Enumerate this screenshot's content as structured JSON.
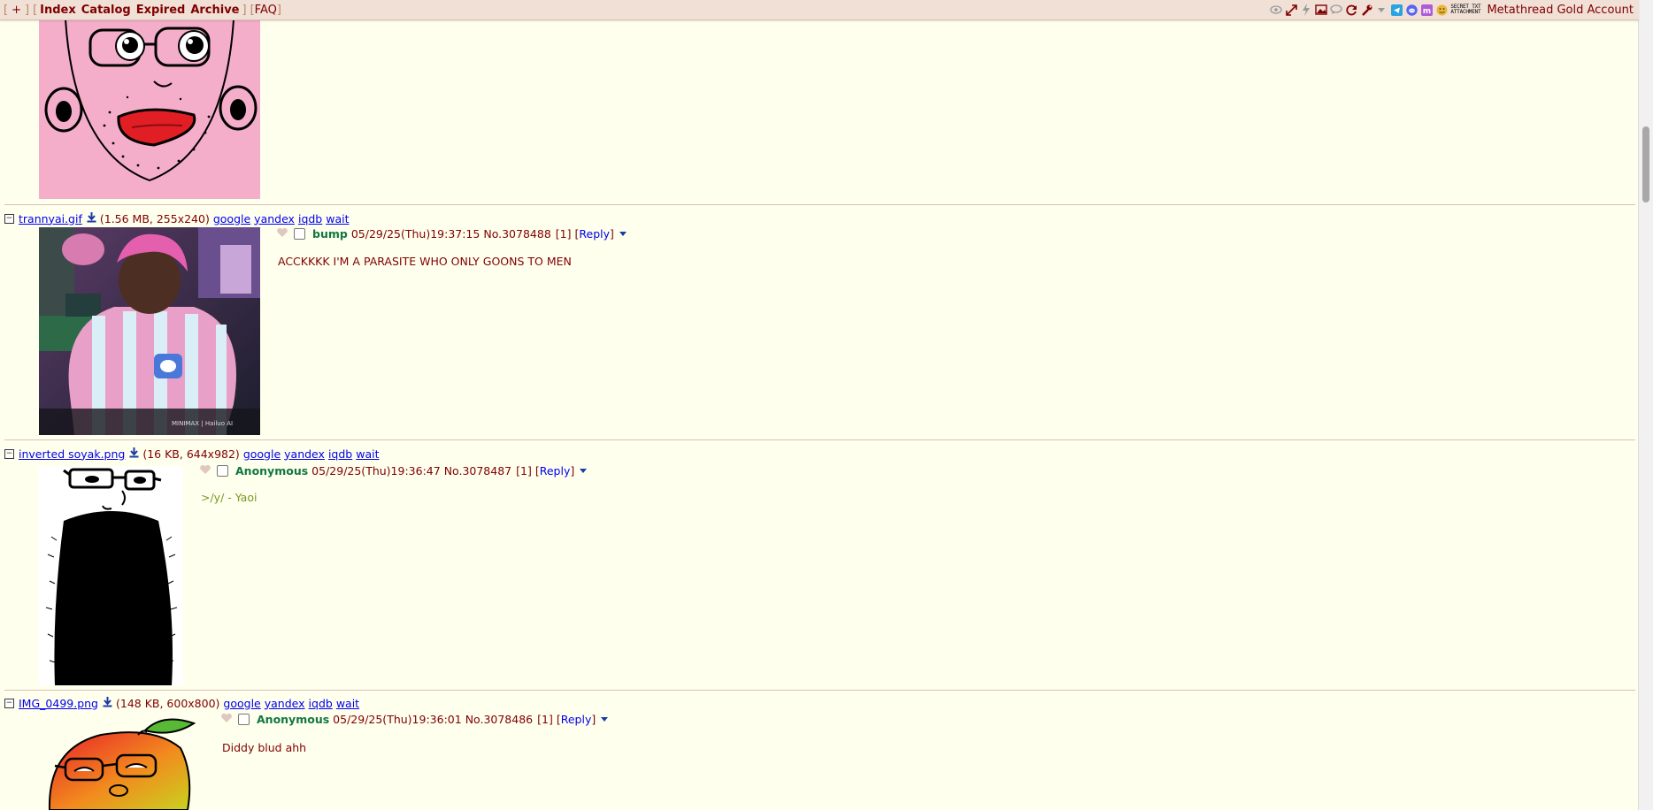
{
  "topbar": {
    "bracket_open": "[",
    "plus": "+",
    "bracket_close": "]",
    "links": [
      "Index",
      "Catalog",
      "Expired",
      "Archive"
    ],
    "faq": "FAQ",
    "secret_line1": "SECRET TXT",
    "secret_line2": "ATTACHMENT",
    "account": "Metathread Gold Account",
    "icons": [
      "eye-icon",
      "expand-icon",
      "lightning-icon",
      "image-icon",
      "speech-bubble-icon",
      "refresh-icon",
      "wrench-icon",
      "dropdown-arrow-icon",
      "telegram-icon",
      "discord-icon",
      "matrix-icon",
      "emoji-icon"
    ]
  },
  "posts": [
    {
      "filename": "trannyai.gif",
      "meta": "(1.56 MB, 255x240)",
      "search_links": [
        "google",
        "yandex",
        "iqdb",
        "wait"
      ],
      "name": "bump",
      "datetime": "05/29/25(Thu)19:37:15",
      "number": "No.3078488",
      "replies": "[1]",
      "reply_label": "Reply",
      "message": "ACCKKKK I'M A PARASITE WHO ONLY GOONS TO MEN",
      "greentext": false
    },
    {
      "filename": "inverted soyak.png",
      "meta": "(16 KB, 644x982)",
      "search_links": [
        "google",
        "yandex",
        "iqdb",
        "wait"
      ],
      "name": "Anonymous",
      "datetime": "05/29/25(Thu)19:36:47",
      "number": "No.3078487",
      "replies": "[1]",
      "reply_label": "Reply",
      "message": ">/y/ - Yaoi",
      "greentext": true
    },
    {
      "filename": "IMG_0499.png",
      "meta": "(148 KB, 600x800)",
      "search_links": [
        "google",
        "yandex",
        "iqdb",
        "wait"
      ],
      "name": "Anonymous",
      "datetime": "05/29/25(Thu)19:36:01",
      "number": "No.3078486",
      "replies": "[1]",
      "reply_label": "Reply",
      "message": "Diddy blud ahh",
      "greentext": false
    }
  ],
  "colors": {
    "background": "#ffffee",
    "topbar": "#f0e0d6",
    "name_green": "#117743",
    "text_maroon": "#800000",
    "link_blue": "#0000ee",
    "greentext": "#789922"
  }
}
